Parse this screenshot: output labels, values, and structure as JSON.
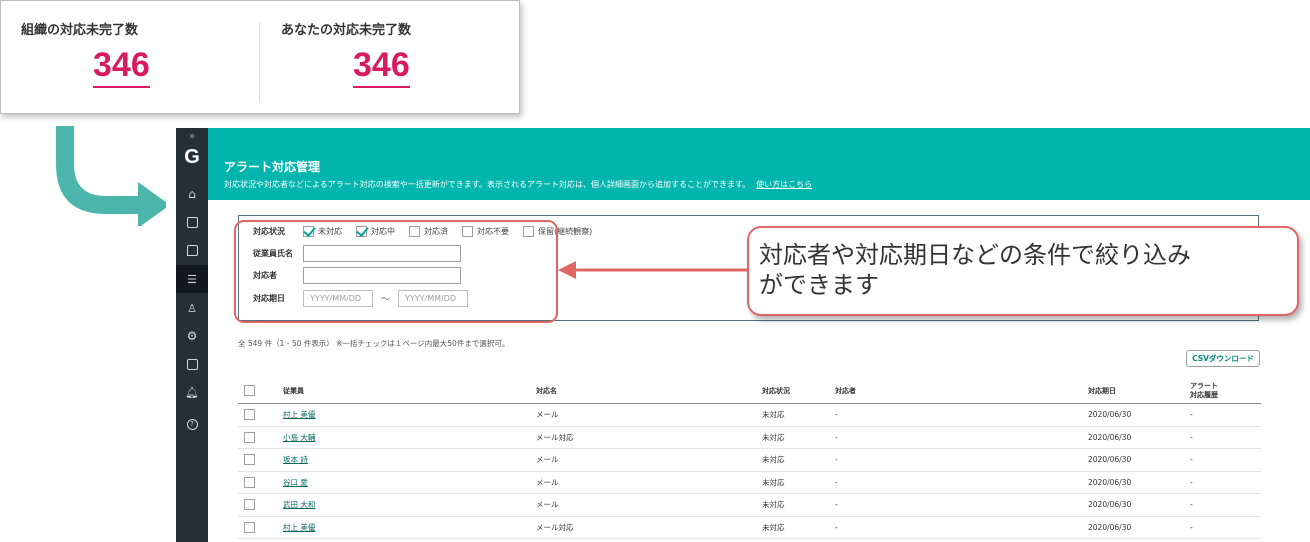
{
  "summary": {
    "org_label": "組織の対応未完了数",
    "org_value": "346",
    "you_label": "あなたの対応未完了数",
    "you_value": "346"
  },
  "sidebar": {
    "expand": "»",
    "logo": "G",
    "items": [
      "home-icon",
      "document-icon",
      "chat-icon",
      "list-icon",
      "people-icon",
      "settings-icon",
      "org-icon",
      "bell-icon",
      "help-icon"
    ],
    "active_index": 3
  },
  "header": {
    "title": "アラート対応管理",
    "description": "対応状況や対応者などによるアラート対応の検索や一括更新ができます。表示されるアラート対応は、個人詳細画面から追加することができます。",
    "help_link": "使い方はこちら",
    "bg_color": "#00b5ad"
  },
  "filter": {
    "status_label": "対応状況",
    "statuses": [
      {
        "label": "未対応",
        "checked": true
      },
      {
        "label": "対応中",
        "checked": true
      },
      {
        "label": "対応済",
        "checked": false
      },
      {
        "label": "対応不要",
        "checked": false
      },
      {
        "label": "保留(継続観察)",
        "checked": false
      }
    ],
    "employee_label": "従業員氏名",
    "employee_value": "",
    "assignee_label": "対応者",
    "assignee_value": "",
    "due_label": "対応期日",
    "due_from_placeholder": "YYYY/MM/DD",
    "due_to_placeholder": "YYYY/MM/DD",
    "tilde": "〜"
  },
  "results": {
    "count_text": "全 549 件（1 - 50 件表示） ※一括チェックは１ページ内最大50件まで選択可。",
    "csv_button": "CSVダウンロード"
  },
  "table": {
    "headers": {
      "employee": "従業員",
      "name": "対応名",
      "status": "対応状況",
      "assignee": "対応者",
      "due": "対応期日",
      "history_1": "アラート",
      "history_2": "対応履歴"
    },
    "rows": [
      {
        "employee": "村上 美優",
        "name": "メール",
        "status": "未対応",
        "assignee": "-",
        "due": "2020/06/30",
        "history": "-"
      },
      {
        "employee": "小島 大輔",
        "name": "メール対応",
        "status": "未対応",
        "assignee": "-",
        "due": "2020/06/30",
        "history": "-"
      },
      {
        "employee": "坂本 詩",
        "name": "メール",
        "status": "未対応",
        "assignee": "-",
        "due": "2020/06/30",
        "history": "-"
      },
      {
        "employee": "谷口 愛",
        "name": "メール",
        "status": "未対応",
        "assignee": "-",
        "due": "2020/06/30",
        "history": "-"
      },
      {
        "employee": "武田 大和",
        "name": "メール",
        "status": "未対応",
        "assignee": "-",
        "due": "2020/06/30",
        "history": "-"
      },
      {
        "employee": "村上 美優",
        "name": "メール対応",
        "status": "未対応",
        "assignee": "-",
        "due": "2020/06/30",
        "history": "-"
      }
    ]
  },
  "callout": {
    "text_line1": "対応者や対応期日などの条件で絞り込み",
    "text_line2": "ができます",
    "border_color": "#e06666"
  },
  "arrow_color": "#4db6ac"
}
